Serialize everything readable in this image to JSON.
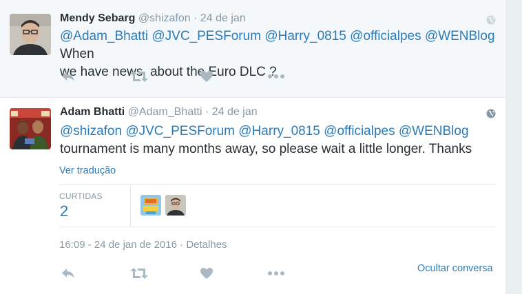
{
  "tweets": [
    {
      "name": "Mendy Sebarg",
      "handle": "@shizafon",
      "sep": "·",
      "date": "24 de jan",
      "mentions": [
        "@Adam_Bhatti",
        "@JVC_PESForum",
        "@Harry_0815",
        "@officialpes",
        "@WENBlog"
      ],
      "text_line1_tail": "When",
      "text_line2": "we have news, about the Euro DLC ?"
    },
    {
      "name": "Adam Bhatti",
      "handle": "@Adam_Bhatti",
      "sep": "·",
      "date": "24 de jan",
      "mentions": [
        "@shizafon",
        "@JVC_PESForum",
        "@Harry_0815",
        "@officialpes",
        "@WENBlog"
      ],
      "text_line2": "tournament is many months away, so please wait a little longer. Thanks",
      "translate": "Ver tradução",
      "likes_label": "CURTIDAS",
      "likes_count": "2",
      "timestamp": "16:09 - 24 de jan de 2016",
      "details": "Detalhes",
      "hide_conversation": "Ocultar conversa"
    }
  ],
  "icons": [
    "reply-icon",
    "retweet-icon",
    "like-icon",
    "more-icon",
    "globe-icon"
  ],
  "colors": {
    "link": "#2b7bb9",
    "muted": "#8899a6",
    "icon": "#aab8c2"
  }
}
